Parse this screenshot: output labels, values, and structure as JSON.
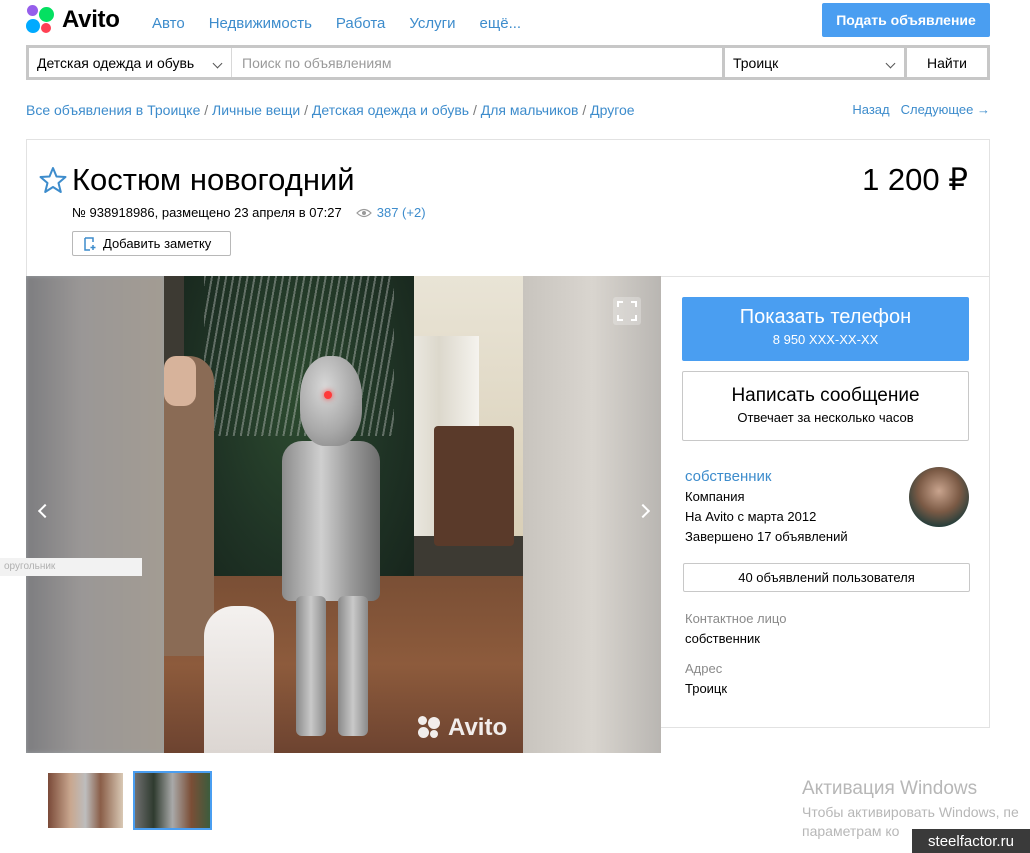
{
  "header": {
    "logo_text": "Avito",
    "nav": [
      "Авто",
      "Недвижимость",
      "Работа",
      "Услуги",
      "ещё..."
    ],
    "post_button": "Подать объявление"
  },
  "search": {
    "category": "Детская одежда и обувь",
    "placeholder": "Поиск по объявлениям",
    "city": "Троицк",
    "find_button": "Найти"
  },
  "breadcrumbs": [
    "Все объявления в Троицке",
    "Личные вещи",
    "Детская одежда и обувь",
    "Для мальчиков",
    "Другое"
  ],
  "pager": {
    "back": "Назад",
    "next": "Следующее →"
  },
  "listing": {
    "title": "Костюм новогодний",
    "price": "1 200 ₽",
    "meta": "№ 938918986, размещено 23 апреля в 07:27",
    "views": "387 (+2)",
    "note_button": "Добавить заметку",
    "watermark": "Avito"
  },
  "side_tag": "оругольник",
  "contact_panel": {
    "phone_button": "Показать телефон",
    "phone_number": "8 950 XXX-XX-XX",
    "message_button": "Написать сообщение",
    "message_sub": "Отвечает за несколько часов",
    "seller_name": "собственник",
    "seller_type": "Компания",
    "seller_since": "На Avito с марта 2012",
    "seller_done": "Завершено 17 объявлений",
    "ads_button": "40 объявлений пользователя",
    "contact_label": "Контактное лицо",
    "contact_value": "собственник",
    "address_label": "Адрес",
    "address_value": "Троицк"
  },
  "overlay": {
    "windows_title": "Активация Windows",
    "windows_line1": "Чтобы активировать Windows, пе",
    "windows_line2": "параметрам ко",
    "site": "steelfactor.ru"
  },
  "colors": {
    "accent": "#4a9ef1",
    "link": "#3d8ccc"
  }
}
